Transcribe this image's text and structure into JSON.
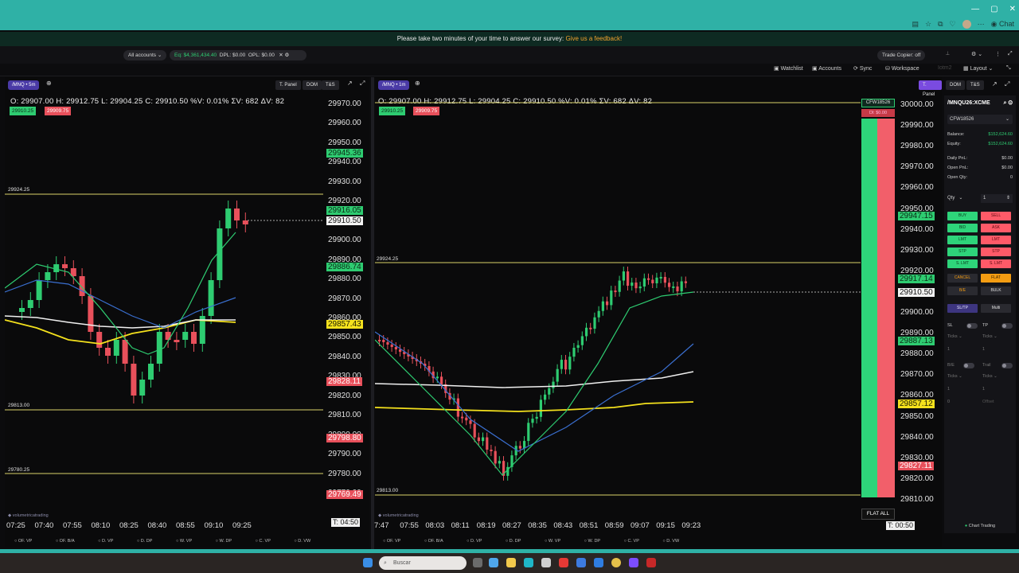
{
  "window": {
    "chat_label": "Chat",
    "controls": [
      "—",
      "▢",
      "✕"
    ]
  },
  "survey": {
    "text": "Please take two minutes of your time to answer our survey:",
    "link": "Give us a feedback!"
  },
  "accountbar": {
    "accounts_select": "All accounts",
    "equity": "Eq: $4,361,434.40",
    "dpl": "DPL: $0.00",
    "opl": "OPL: $0.00",
    "trade_copier": "Trade Copier: off"
  },
  "toolbar": {
    "watchlist": "Watchlist",
    "accounts": "Accounts",
    "sync": "Sync",
    "workspace": "Workspace",
    "layout": "Layout",
    "ghost_tab": "Iotm2"
  },
  "left_chart": {
    "symbol": "/MNQ",
    "timeframe": "5m",
    "buttons": [
      "T. Panel",
      "DOM",
      "T&S"
    ],
    "ohlc": "O: 29907.00  H: 29912.75  L: 29904.25  C: 29910.50  %V: 0.01%  ΣV: 682  ΔV: 82",
    "bid_chip": "29910.25",
    "ask_chip": "29909.75",
    "price_axis": [
      "29970.00",
      "29960.00",
      "29950.00",
      "29940.00",
      "29930.00",
      "29920.00",
      "29910.00",
      "29900.00",
      "29890.00",
      "29880.00",
      "29870.00",
      "29860.00",
      "29850.00",
      "29840.00",
      "29830.00",
      "29820.00",
      "29810.00",
      "29800.00",
      "29790.00",
      "29780.00",
      "29770.00"
    ],
    "tags": {
      "green_top": "29945.36",
      "green_last": "29916.05",
      "white_last": "29910.50",
      "green_mid": "29886.74",
      "yellow": "29857.43",
      "red_mid": "29828.11",
      "red_low": "29798.80",
      "red_bottom": "29769.49"
    },
    "hlines": {
      "top": "29924.25",
      "mid": "29813.00",
      "low": "29780.25"
    },
    "time_axis": [
      "07:25",
      "07:40",
      "07:55",
      "08:10",
      "08:25",
      "08:40",
      "08:55",
      "09:10",
      "09:25"
    ],
    "timer": "T: 04:50",
    "bottom_tabs": [
      "OF. VP",
      "OF. B/A",
      "D. VP",
      "D. DP",
      "W. VP",
      "W. DP",
      "C. VP",
      "D. VW"
    ],
    "watermark": "volumetricatrading"
  },
  "right_chart": {
    "symbol": "/MNQ",
    "timeframe": "1m",
    "buttons": [
      "T. Panel",
      "DOM",
      "T&S"
    ],
    "ohlc": "O: 29907.00  H: 29912.75  L: 29904.25  C: 29910.50  %V: 0.01%  ΣV: 682  ΔV: 82",
    "bid_chip": "29910.25",
    "ask_chip": "29909.75",
    "price_axis": [
      "30000.00",
      "29990.00",
      "29980.00",
      "29970.00",
      "29960.00",
      "29950.00",
      "29940.00",
      "29930.00",
      "29920.00",
      "29910.00",
      "29900.00",
      "29890.00",
      "29880.00",
      "29870.00",
      "29860.00",
      "29850.00",
      "29840.00",
      "29830.00",
      "29820.00",
      "29810.00"
    ],
    "tags": {
      "green_top": "29947.15",
      "green_last": "29917.14",
      "white_last": "29910.50",
      "green_mid": "29887.13",
      "yellow": "29857.12",
      "red": "29827.11"
    },
    "hlines": {
      "top": "29924.25",
      "low": "29813.00"
    },
    "time_axis": [
      "7:47",
      "07:55",
      "08:03",
      "08:11",
      "08:19",
      "08:27",
      "08:35",
      "08:43",
      "08:51",
      "08:59",
      "09:07",
      "09:15",
      "09:23"
    ],
    "timer": "T: 00:50",
    "account_badge": "CFW18526",
    "dl_badge": "Dl: $0.00",
    "flat_all": "FLAT ALL",
    "bottom_tabs": [
      "OF. VP",
      "OF. B/A",
      "D. VP",
      "D. DP",
      "W. VP",
      "W. DP",
      "C. VP",
      "D. VW"
    ],
    "watermark": "volumetricatrading"
  },
  "dom_panel": {
    "instrument": "/MNQU26:XCME",
    "account": "CFW18526",
    "balance_label": "Balance:",
    "balance": "$152,624.60",
    "equity_label": "Equity:",
    "equity": "$152,624.60",
    "daily_pnl_label": "Daily PnL:",
    "daily_pnl": "$0.00",
    "open_pnl_label": "Open PnL:",
    "open_pnl": "$0.00",
    "open_qty_label": "Open Qty:",
    "open_qty": "0",
    "qty_label": "Qty",
    "qty_value": "1",
    "buttons": {
      "buy": "BUY",
      "sell": "SELL",
      "bid": "BID",
      "ask": "ASK",
      "lmt_b": "LMT",
      "lmt_s": "LMT",
      "stp_b": "STP",
      "stp_s": "STP",
      "slmt_b": "S. LMT",
      "slmt_s": "S. LMT",
      "cancel": "CANCEL",
      "flat": "FLAT",
      "be": "B/E",
      "bulk": "BULK",
      "sltp": "SL/TP",
      "multi": "Multi"
    },
    "sl_label": "SL",
    "tp_label": "TP",
    "ticks_label": "Ticks",
    "be_label": "B/E",
    "trail_label": "Trail",
    "offset_label": "Offset",
    "chart_trading": "Chart Trading"
  },
  "taskbar": {
    "search_placeholder": "Buscar"
  }
}
